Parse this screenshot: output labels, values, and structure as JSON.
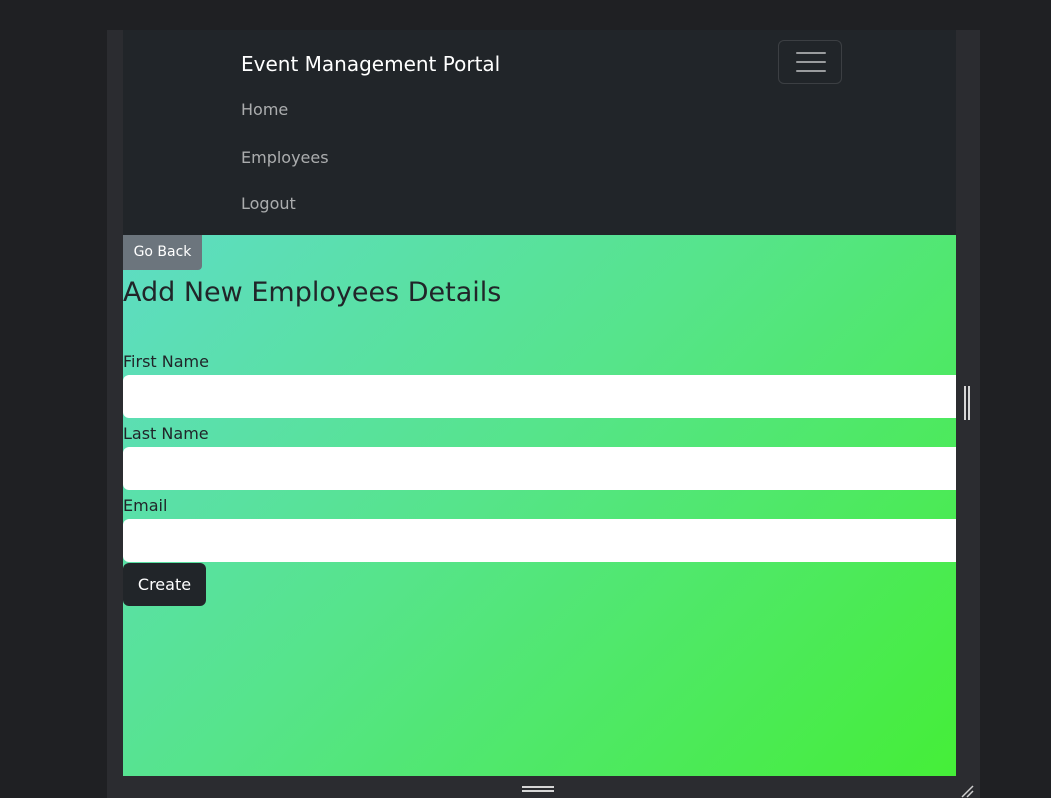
{
  "navbar": {
    "brand": "Event Management Portal",
    "links": [
      {
        "label": "Home"
      },
      {
        "label": "Employees"
      },
      {
        "label": "Logout"
      }
    ]
  },
  "content": {
    "go_back_label": "Go Back",
    "title": "Add New Employees Details",
    "fields": [
      {
        "label": "First Name",
        "value": ""
      },
      {
        "label": "Last Name",
        "value": ""
      },
      {
        "label": "Email",
        "value": ""
      }
    ],
    "submit_label": "Create"
  },
  "icons": {
    "toggler": "hamburger-menu-icon",
    "side_grip": "vertical-splitter-grip-icon",
    "bottom_grip": "horizontal-splitter-grip-icon",
    "resize": "resize-corner-icon"
  },
  "colors": {
    "navbar_bg": "#212529",
    "gradient_start": "#5edcc4",
    "gradient_end": "#45ee38",
    "go_back_bg": "#6c757d",
    "create_bg": "#212529"
  }
}
